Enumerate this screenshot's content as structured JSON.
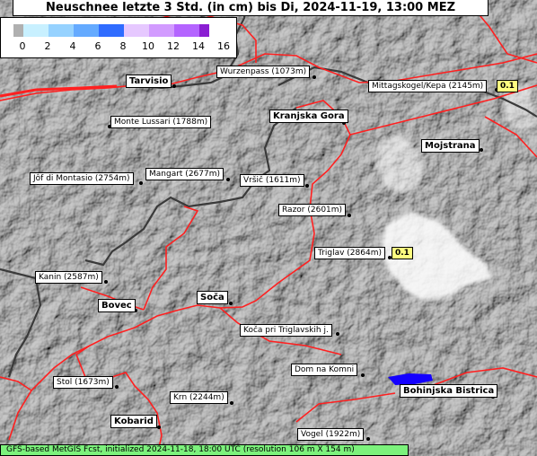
{
  "title": "Neuschnee letzte 3 Std. (in cm) bis Di, 2024-11-19, 13:00 MEZ",
  "legend": {
    "labels": [
      "0",
      "2",
      "4",
      "6",
      "8",
      "10",
      "12",
      "14",
      "16"
    ],
    "colors": [
      "#b0b0b0",
      "#c8f0ff",
      "#96d2ff",
      "#64aaff",
      "#2f6cff",
      "#e6c8ff",
      "#d29bff",
      "#b464ff",
      "#8a1ed2"
    ]
  },
  "places": {
    "wurzenpass": "Wurzenpass (1073m)",
    "mittagskogel": "Mittagskogel/Kepa (2145m)",
    "monte_lussari": "Monte Lussari (1788m)",
    "jof_di_montasio": "Jôf di Montasio (2754m)",
    "mangart": "Mangart (2677m)",
    "vrsic": "Vršič (1611m)",
    "razor": "Razor (2601m)",
    "triglav": "Triglav (2864m)",
    "kanin": "Kanin (2587m)",
    "koca": "Koča pri Triglavskih j.",
    "dom_na_komni": "Dom na Komni",
    "stol": "Stol (1673m)",
    "krn": "Krn (2244m)",
    "vogel": "Vogel (1922m)"
  },
  "towns": {
    "tarvisio": "Tarvisio",
    "kranjska_gora": "Kranjska Gora",
    "mojstrana": "Mojstrana",
    "bovec": "Bovec",
    "soca": "Soča",
    "bohinjska_bistrica": "Bohinjska Bistrica",
    "kobarid": "Kobarid"
  },
  "values": {
    "mittagskogel": "0.1",
    "triglav": "0.1"
  },
  "footer": "GFS-based MetGIS Fcst, initialized 2024-11-18, 18:00 UTC  (resolution 106 m X 154 m)"
}
